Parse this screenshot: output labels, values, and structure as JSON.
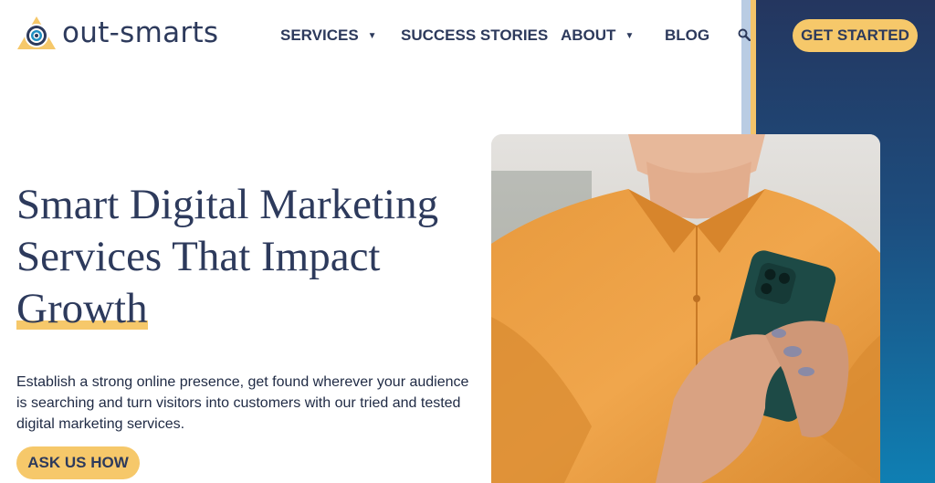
{
  "brand": {
    "name": "out-smarts"
  },
  "nav": {
    "services": "SERVICES",
    "success_stories": "SUCCESS STORIES",
    "about": "ABOUT",
    "blog": "BLOG",
    "cta": "GET STARTED"
  },
  "hero": {
    "title_line1": "Smart Digital Marketing",
    "title_line2": "Services That Impact",
    "title_highlight": "Growth",
    "description": "Establish a strong online presence, get found wherever your audience is searching and turn visitors into customers with our tried and tested digital marketing services.",
    "cta": "ASK US HOW"
  },
  "colors": {
    "navy": "#2d3a5c",
    "gold": "#f6c86a",
    "blue_gradient_top": "#24365f",
    "blue_gradient_bottom": "#0f7fb3"
  },
  "icons": {
    "logo": "target-triangle-icon",
    "search": "search-icon",
    "dropdown": "caret-down-icon"
  }
}
